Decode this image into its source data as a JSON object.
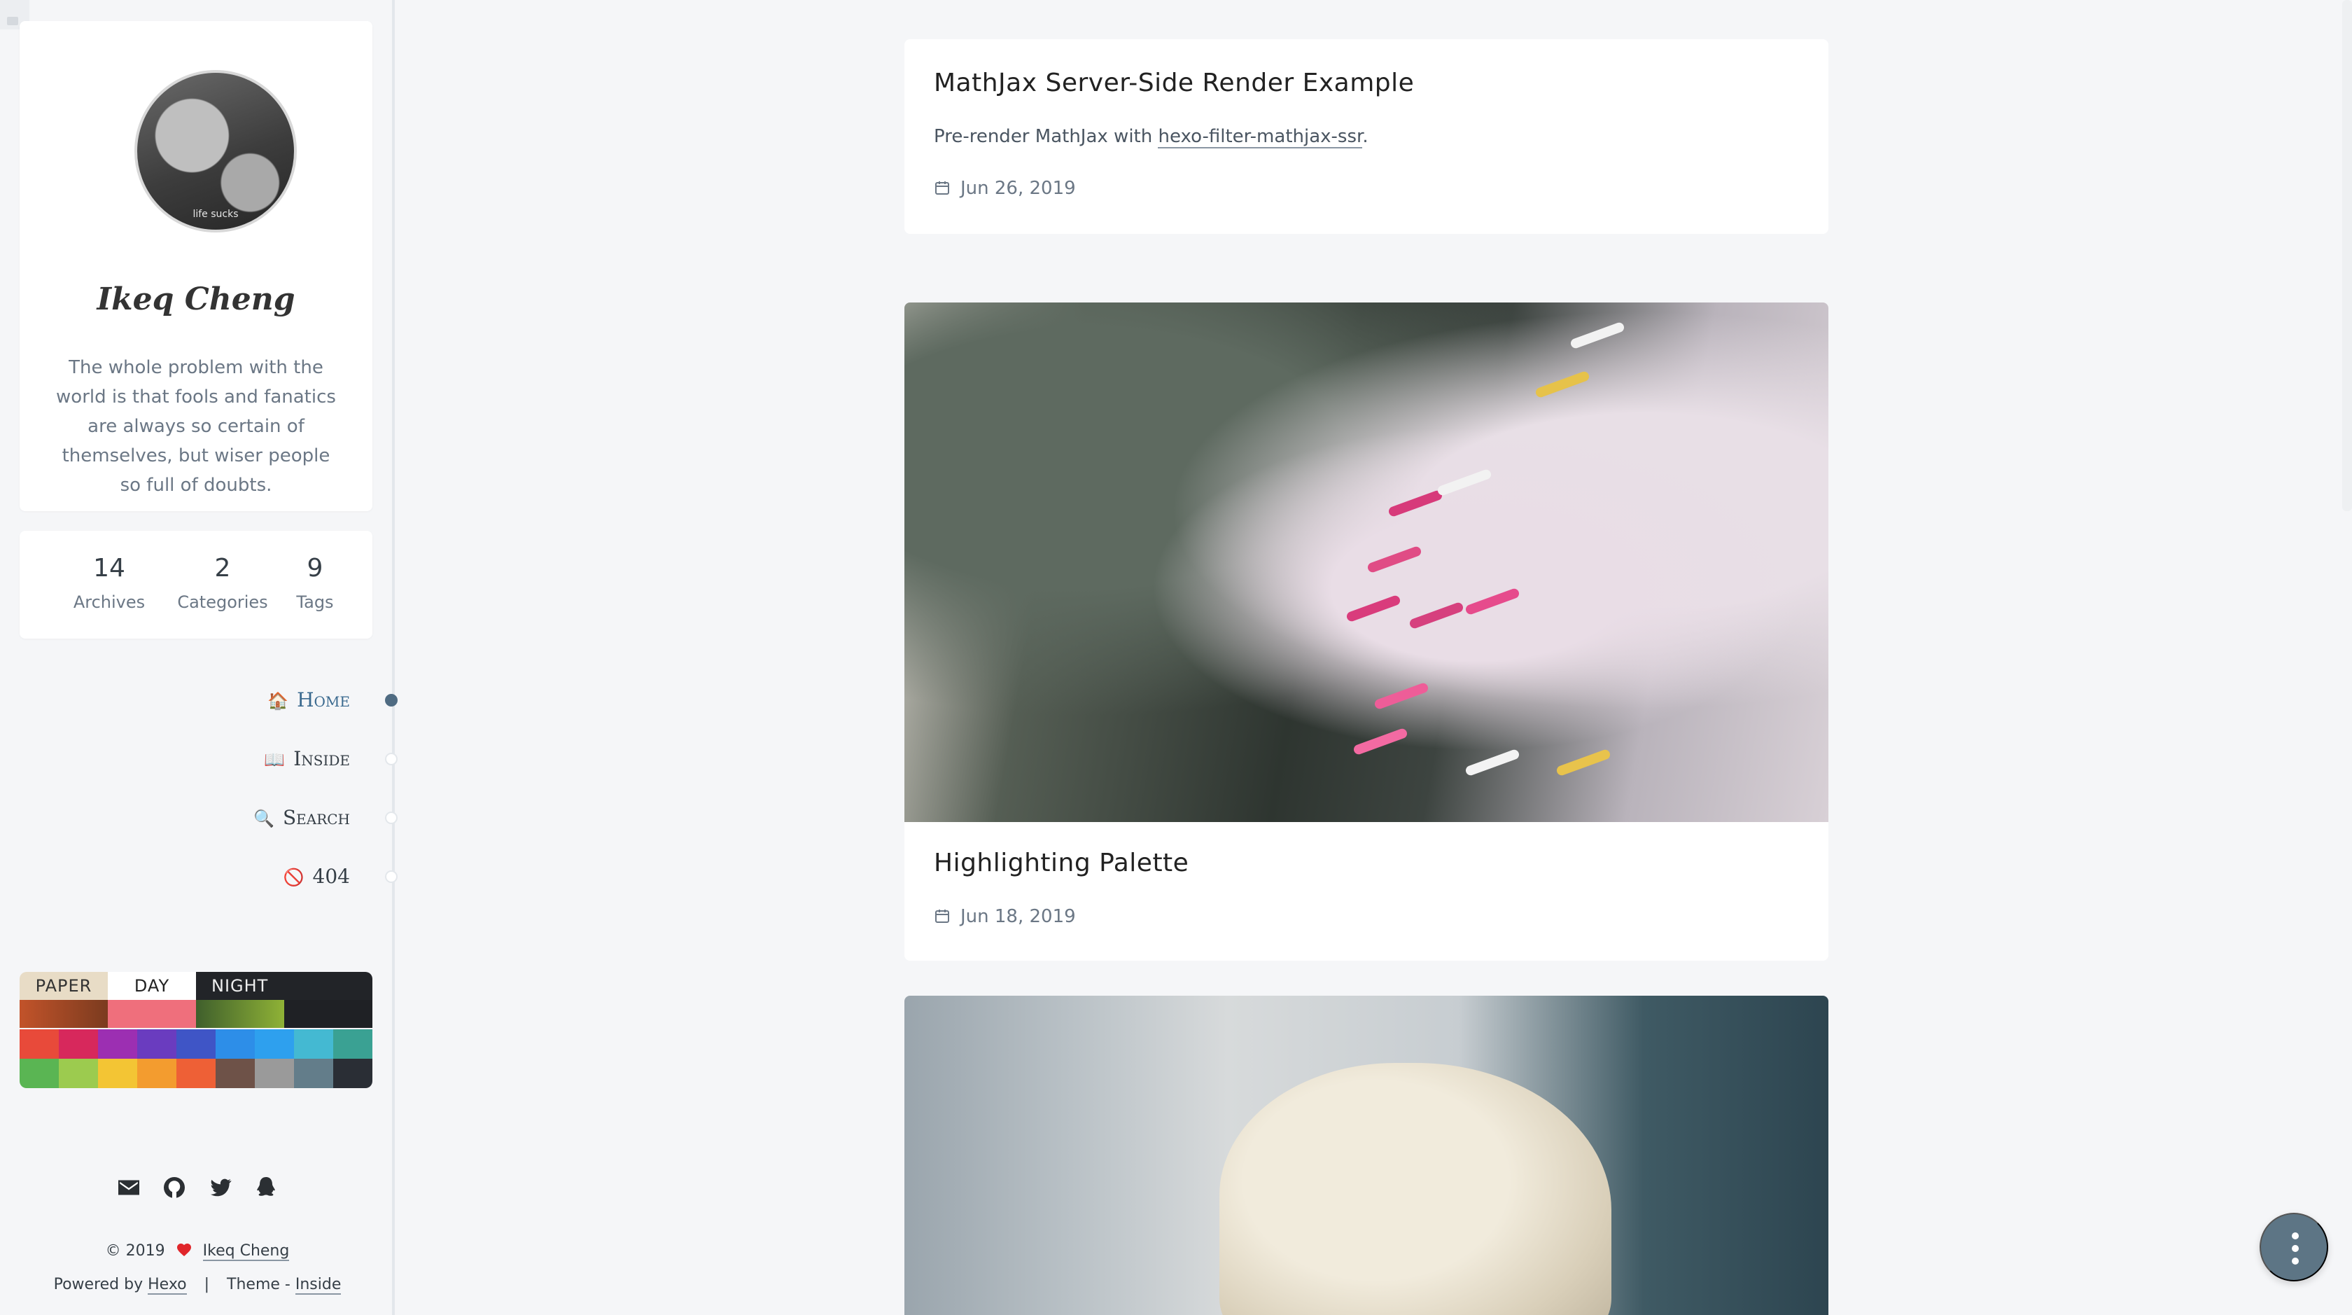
{
  "sidebar": {
    "avatar_text": "life sucks",
    "author_name": "Ikeq Cheng",
    "bio": "The whole problem with the world is that fools and fanatics are always so certain of themselves, but wiser people so full of doubts.",
    "stats": [
      {
        "num": "14",
        "label": "Archives"
      },
      {
        "num": "2",
        "label": "Categories"
      },
      {
        "num": "9",
        "label": "Tags"
      }
    ],
    "nav": [
      {
        "emoji": "🏠",
        "label": "Home"
      },
      {
        "emoji": "📖",
        "label": "Inside"
      },
      {
        "emoji": "🔍",
        "label": "Search"
      },
      {
        "emoji": "🚫",
        "label": "404"
      }
    ],
    "theme_tabs": {
      "paper": "PAPER",
      "day": "DAY",
      "night": "NIGHT"
    },
    "swatches_row1": [
      "#e84a3a",
      "#d7285c",
      "#9c2fb2",
      "#6a3cbf",
      "#3f55c6",
      "#2d8ee8",
      "#2ea0ee",
      "#44b9d2",
      "#3aa193"
    ],
    "swatches_row2": [
      "#5ab553",
      "#9ccb4f",
      "#f3c534",
      "#f39c2f",
      "#ee6036",
      "#6e5248",
      "#9a9a9a",
      "#637d8a",
      "#2a2e35"
    ],
    "footer": {
      "copyright": "© 2019",
      "author_link": "Ikeq Cheng",
      "powered_by": "Powered by",
      "hexo": "Hexo",
      "separator": "|",
      "theme": "Theme -",
      "inside": "Inside"
    }
  },
  "posts": [
    {
      "title": "MathJax Server-Side Render Example",
      "excerpt_prefix": "Pre-render MathJax with",
      "excerpt_link": "hexo-filter-mathjax-ssr",
      "excerpt_suffix": ".",
      "date": "Jun 26, 2019"
    },
    {
      "title": "Highlighting Palette",
      "date": "Jun 18, 2019"
    }
  ],
  "colors": {
    "accent": "#5d7585",
    "background": "#f5f6f8"
  }
}
